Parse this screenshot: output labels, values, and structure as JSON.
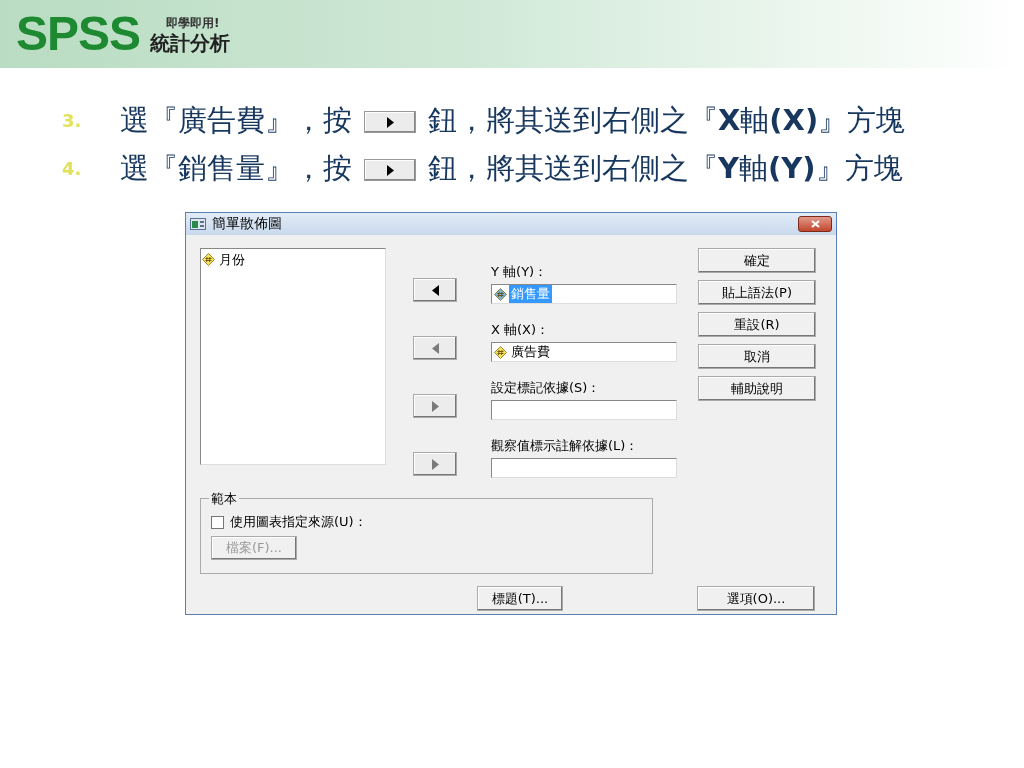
{
  "header": {
    "logo": "SPSS",
    "tagline": "即學即用!",
    "subtitle": "統計分析"
  },
  "steps": [
    {
      "number": "3.",
      "before": "選『廣告費』，按",
      "after": "鈕，將其送到右側之『**X**軸**(X)**』方塊"
    },
    {
      "number": "4.",
      "before": "選『銷售量』，按",
      "after": "鈕，將其送到右側之『**Y**軸**(Y)**』方塊"
    }
  ],
  "dialog": {
    "title": "簡單散佈圖",
    "source_list": [
      {
        "name": "月份",
        "selected": false
      }
    ],
    "fields": [
      {
        "label": "Y 軸(Y)：",
        "kind": "left",
        "arrow_disabled": false,
        "items": [
          {
            "name": "銷售量",
            "selected": true
          }
        ]
      },
      {
        "label": "X 軸(X)：",
        "kind": "left",
        "arrow_disabled": true,
        "items": [
          {
            "name": "廣告費",
            "selected": false
          }
        ]
      },
      {
        "label": "設定標記依據(S)：",
        "kind": "right",
        "arrow_disabled": true
      },
      {
        "label": "觀察值標示註解依據(L)：",
        "kind": "right",
        "arrow_disabled": true
      }
    ],
    "buttons": [
      "確定",
      "貼上語法(P)",
      "重設(R)",
      "取消",
      "輔助說明"
    ],
    "template": {
      "title": "範本",
      "checkbox_label": "使用圖表指定來源(U)：",
      "checked": false,
      "file_button": "檔案(F)...",
      "file_disabled": true
    },
    "titles_button": "標題(T)...",
    "options_button": "選項(O)..."
  }
}
